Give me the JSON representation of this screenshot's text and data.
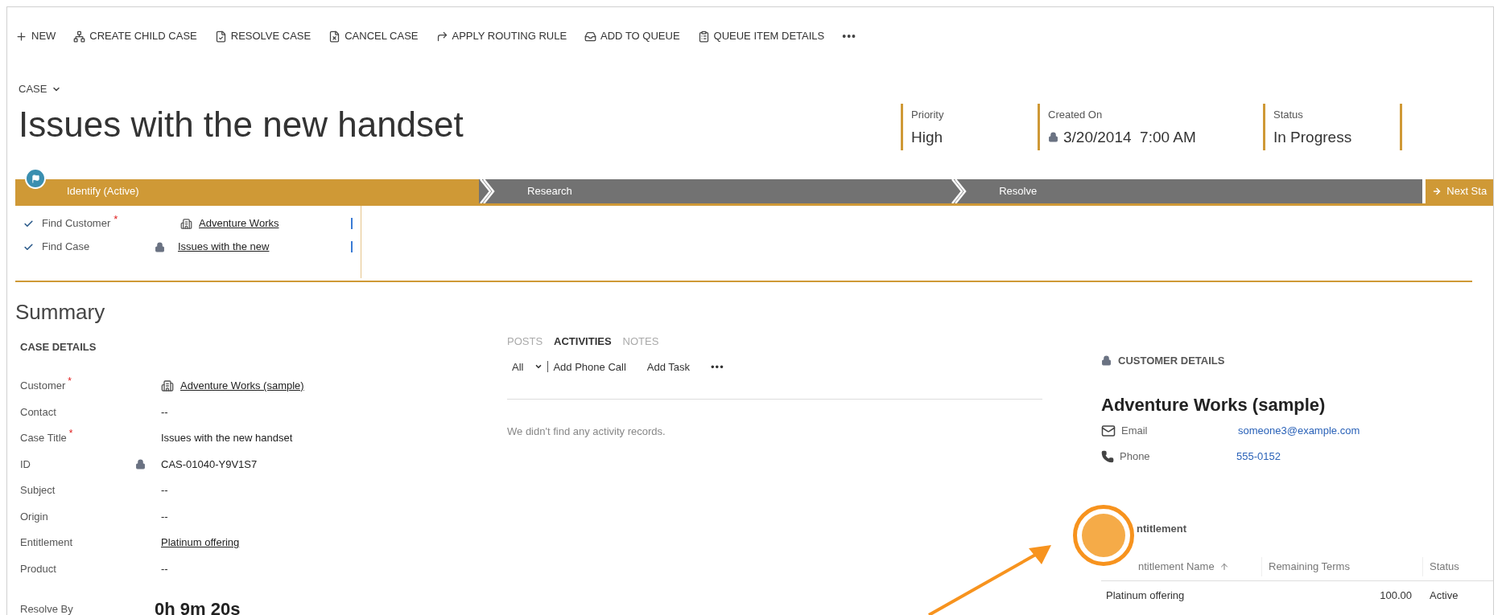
{
  "toolbar": [
    {
      "label": "NEW"
    },
    {
      "label": "CREATE CHILD CASE"
    },
    {
      "label": "RESOLVE CASE"
    },
    {
      "label": "CANCEL CASE"
    },
    {
      "label": "APPLY ROUTING RULE"
    },
    {
      "label": "ADD TO QUEUE"
    },
    {
      "label": "QUEUE ITEM DETAILS"
    }
  ],
  "toolbar_more": "•••",
  "entity_selector": "CASE",
  "title": "Issues with the new handset",
  "header_fields": [
    {
      "label": "Priority",
      "value": "High",
      "locked": false
    },
    {
      "label": "Created On",
      "value": "3/20/2014  7:00 AM",
      "locked": true
    },
    {
      "label": "Status",
      "value": "In Progress",
      "locked": false
    }
  ],
  "process": {
    "stages": [
      {
        "label": "Identify (Active)",
        "selected": true
      },
      {
        "label": "Research",
        "selected": false
      },
      {
        "label": "Resolve",
        "selected": false
      }
    ],
    "next": "Next Sta",
    "steps": [
      {
        "label": "Find Customer",
        "required_mark": "*",
        "done": true,
        "locked": false,
        "value": "Adventure Works"
      },
      {
        "label": "Find Case",
        "done": true,
        "locked": true,
        "value": "Issues with the new"
      }
    ]
  },
  "summary": {
    "title": "Summary",
    "section": "CASE DETAILS",
    "fields": [
      {
        "label": "Customer",
        "required_mark": "*",
        "locked": false,
        "kind": "lookup",
        "value": "Adventure Works (sample)"
      },
      {
        "label": "Contact",
        "locked": false,
        "kind": "text",
        "value": "--"
      },
      {
        "label": "Case Title",
        "required_mark": "*",
        "locked": false,
        "kind": "text",
        "value": "Issues with the new handset"
      },
      {
        "label": "ID",
        "locked": true,
        "kind": "text",
        "value": "CAS-01040-Y9V1S7"
      },
      {
        "label": "Subject",
        "locked": false,
        "kind": "text",
        "value": "--"
      },
      {
        "label": "Origin",
        "locked": false,
        "kind": "text",
        "value": "--"
      },
      {
        "label": "Entitlement",
        "locked": false,
        "kind": "link",
        "value": "Platinum offering"
      },
      {
        "label": "Product",
        "locked": false,
        "kind": "text",
        "value": "--"
      }
    ],
    "resolve_by": {
      "label": "Resolve By",
      "value": "0h 9m 20s"
    }
  },
  "activities": {
    "tabs": [
      {
        "label": "POSTS",
        "selected": false
      },
      {
        "label": "ACTIVITIES",
        "selected": true
      },
      {
        "label": "NOTES",
        "selected": false
      }
    ],
    "filter": "All",
    "actions": [
      "Add Phone Call",
      "Add Task"
    ],
    "more": "•••",
    "empty": "We didn't find any activity records."
  },
  "customer": {
    "section": "CUSTOMER DETAILS",
    "name": "Adventure Works (sample)",
    "contacts": [
      {
        "kind": "email",
        "label": "Email",
        "value": "someone3@example.com"
      },
      {
        "kind": "phone",
        "label": "Phone",
        "value": "555-0152"
      }
    ]
  },
  "entitlement": {
    "title": "ntitlement",
    "columns": [
      {
        "label": "ntitlement Name",
        "sorted": true
      },
      {
        "label": "Remaining Terms",
        "sorted": false
      },
      {
        "label": "Status",
        "sorted": false
      }
    ],
    "rows": [
      [
        "Platinum offering",
        "100.00",
        "Active"
      ]
    ]
  }
}
